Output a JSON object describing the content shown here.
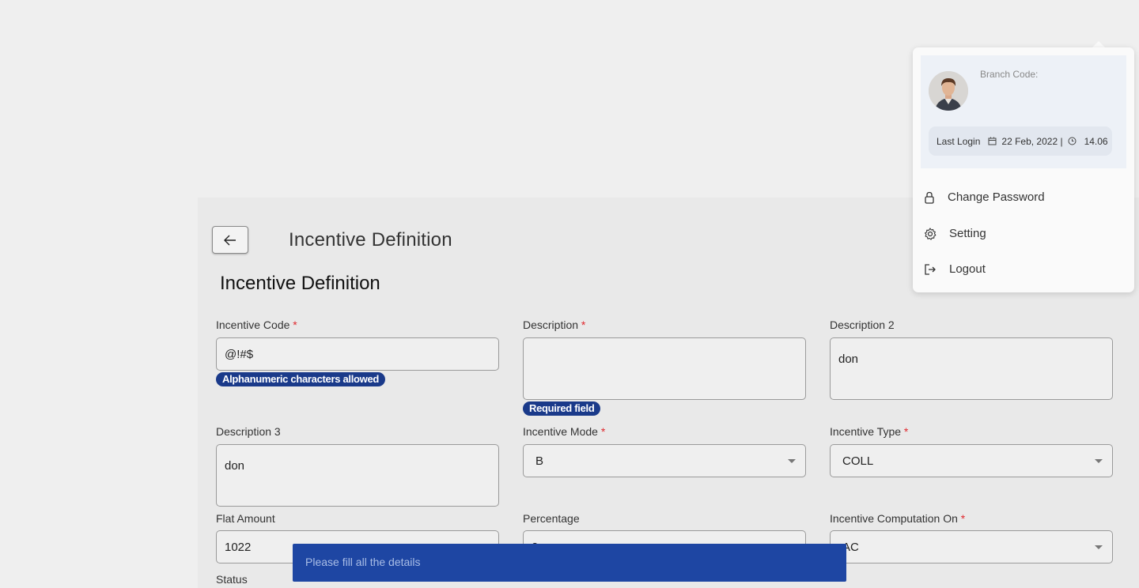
{
  "header": {
    "title": "Incentive Definition"
  },
  "form": {
    "section_title": "Incentive Definition",
    "incentive_code": {
      "label": "Incentive Code",
      "required": "*",
      "value": "@!#$",
      "hint": "Alphanumeric characters allowed"
    },
    "description": {
      "label": "Description",
      "required": "*",
      "value": "",
      "hint": "Required field"
    },
    "description2": {
      "label": "Description 2",
      "value": "don"
    },
    "description3": {
      "label": "Description 3",
      "value": "don"
    },
    "incentive_mode": {
      "label": "Incentive Mode",
      "required": "*",
      "value": "B"
    },
    "incentive_type": {
      "label": "Incentive Type",
      "required": "*",
      "value": "COLL"
    },
    "flat_amount": {
      "label": "Flat Amount",
      "value": "1022"
    },
    "percentage": {
      "label": "Percentage",
      "value": "2"
    },
    "computation_on": {
      "label": "Incentive Computation On",
      "required": "*",
      "value": "AC"
    },
    "status": {
      "label": "Status"
    }
  },
  "toast": {
    "message": "Please fill all the details"
  },
  "profile_menu": {
    "branch_code_label": "Branch Code:",
    "last_login_label": "Last Login",
    "last_login_date": "22 Feb, 2022 |",
    "last_login_time": "14.06",
    "items": [
      {
        "label": "Change Password",
        "icon": "lock-icon"
      },
      {
        "label": "Setting",
        "icon": "gear-icon"
      },
      {
        "label": "Logout",
        "icon": "logout-icon"
      }
    ]
  },
  "colors": {
    "hint_bg": "#1a3a8a",
    "toast_bg": "#1e46a3",
    "required": "#e0282e",
    "save_button": "#b6c4e4"
  }
}
